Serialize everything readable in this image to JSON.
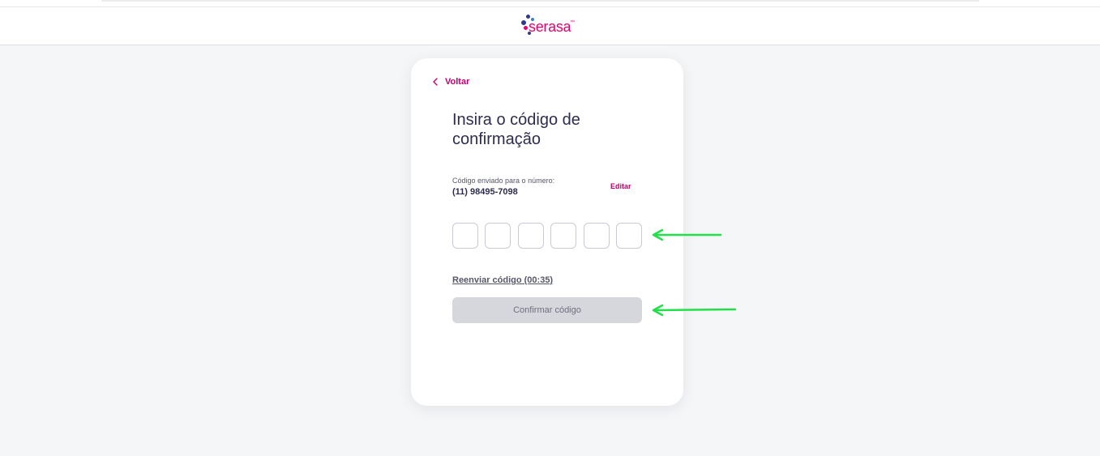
{
  "brand": {
    "name": "serasa",
    "trademark": "™",
    "accent": "#e80070"
  },
  "nav": {
    "back_label": "Voltar",
    "back_icon": "chevron-left-icon"
  },
  "form": {
    "title": "Insira o código de confirmação",
    "sent_label": "Código enviado para o número:",
    "phone": "(11) 98495-7098",
    "edit_label": "Editar",
    "code_digits": [
      "",
      "",
      "",
      "",
      "",
      ""
    ],
    "resend_label": "Reenviar código (00:35)",
    "confirm_label": "Confirmar código"
  },
  "colors": {
    "background": "#f5f6f8",
    "card": "#ffffff",
    "link": "#c4006b",
    "button_disabled": "#d6d7dc",
    "annotation_arrow": "#22e04a"
  }
}
